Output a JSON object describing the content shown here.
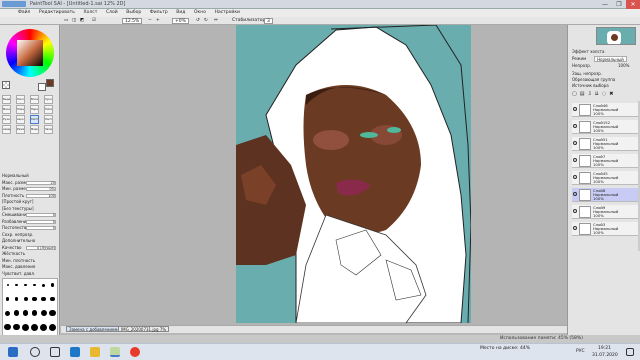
{
  "window": {
    "title": "PaintTool SAI - [Untitled-1.sai 12% 2D]",
    "controls": [
      "—",
      "❐",
      "✕"
    ]
  },
  "menu": [
    "Файл",
    "Редактировать",
    "Холст",
    "Слой",
    "Выбор",
    "Фильтр",
    "Вид",
    "Окно",
    "Настройки"
  ],
  "toolbar": {
    "zoom": "12.5%",
    "rotation": "+0%",
    "stabilizer_label": "Стабилизатор",
    "stabilizer_value": "3"
  },
  "colors": {
    "accent": "#4a7acc",
    "canvas_bg": "#6aadae",
    "skin": "#6b3a22",
    "primary_swatch": "#6b3a22"
  },
  "tools": [
    "Выдел.",
    "Лассо",
    "Волш.",
    "Рука",
    "Масшт.",
    "Повор.",
    "Перем.",
    "Пипетка",
    "Ручка",
    "Аэро.",
    "Кисть",
    "Ластик",
    "Акварель",
    "Размыт.",
    "Маркер",
    "Заливка"
  ],
  "brush_props": {
    "mode": "Нормальный",
    "size_label": "Макс. размер",
    "size_value": "20",
    "min_size_label": "Мин. размер",
    "min_size_value": "0%",
    "density_label": "Плотность",
    "density_value": "100",
    "shape_label": "[Простой круг]",
    "texture_label": "[Без текстуры]",
    "blend_label": "Смешивание",
    "blend_value": "0",
    "dilution_label": "Разбавление",
    "dilution_value": "0",
    "persistence_label": "Постоянство",
    "persistence_value": "0",
    "keep_opacity_label": "Сохр. непрозр.",
    "advanced_label": "Дополнительно",
    "quality_label": "Качество",
    "quality_value": "4 (Лучше)",
    "edge_label": "Жёсткость",
    "min_density_label": "Мин. плотность",
    "max_dens_label": "Макс. давление",
    "pressure_label": "Чувствит. давл.",
    "pressure_options": [
      "Плотн.",
      "Разм.",
      "Смеш."
    ]
  },
  "brush_sizes": [
    "1",
    "1.5",
    "2",
    "2.3",
    "2.6",
    "3",
    "3.5",
    "4",
    "5",
    "6",
    "7",
    "8",
    "9",
    "10",
    "12",
    "14",
    "16",
    "20",
    "25",
    "30",
    "35",
    "40",
    "50",
    "60"
  ],
  "canvas_tabs": [
    {
      "label": "Замена с добавлением...",
      "zoom": "12%"
    },
    {
      "label": "IMG_20200731.jpg",
      "zoom": "7%"
    }
  ],
  "layers_panel": {
    "effects_label": "Эффект холста",
    "mode_label": "Режим",
    "mode_value": "Нормальный",
    "opacity_label": "Непрозр.",
    "opacity_value": "100%",
    "protect_label": "Защ. непрозр.",
    "clip_label": "Обрезающая группа",
    "source_label": "Источник выбора",
    "layers": [
      {
        "name": "Слой46\nНормальный\n100%",
        "selected": false
      },
      {
        "name": "Слой152\nНормальный\n100%",
        "selected": false
      },
      {
        "name": "Слой51\nНормальный\n100%",
        "selected": false
      },
      {
        "name": "Слой7\nНормальный\n100%",
        "selected": false
      },
      {
        "name": "Слой45\nНормальный\n100%",
        "selected": false
      },
      {
        "name": "Слой8\nНормальный\n100%",
        "selected": true
      },
      {
        "name": "Слой9\nНормальный\n100%",
        "selected": false
      },
      {
        "name": "Слой3\nНормальный\n100%",
        "selected": false
      }
    ]
  },
  "status": {
    "memory": "Использование памяти: 45% (58%)",
    "drive": "Место на диске: 44%"
  },
  "taskbar": {
    "lang": "РУС",
    "time": "19:21",
    "date": "31.07.2020"
  }
}
